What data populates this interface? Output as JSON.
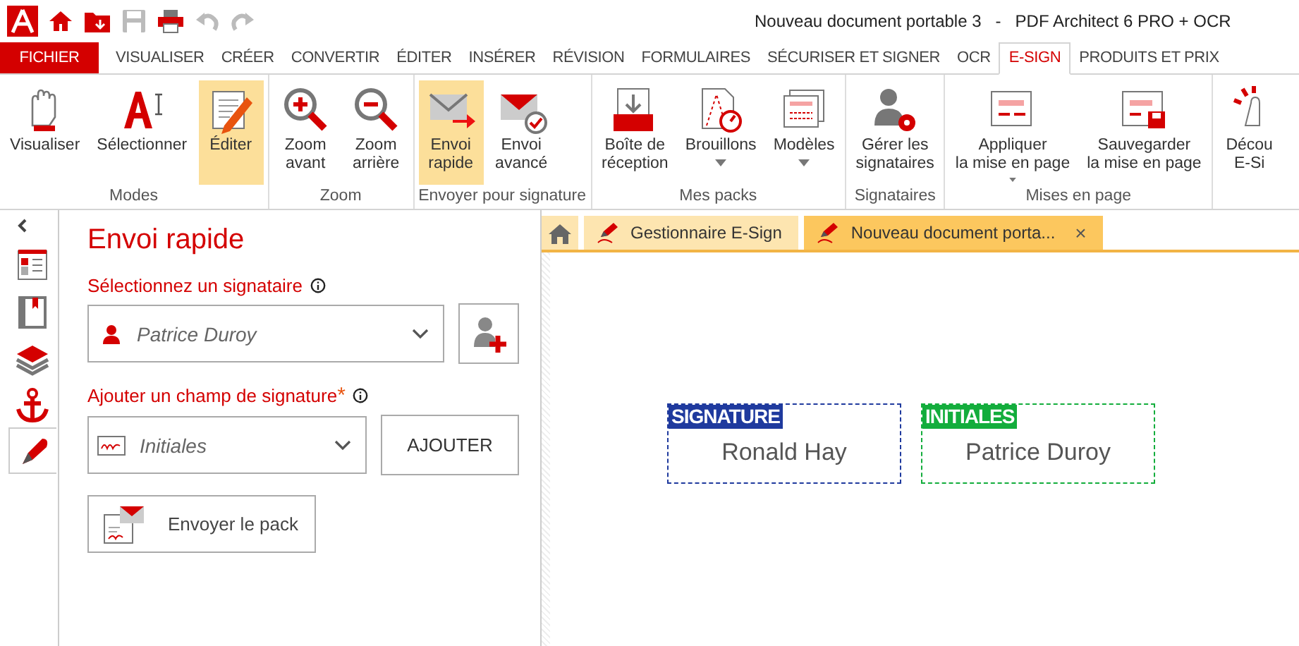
{
  "window": {
    "title": "Nouveau document portable 3   -   PDF Architect 6 PRO + OCR"
  },
  "menu": [
    {
      "label": "FICHIER",
      "kind": "file",
      "selected": false
    },
    {
      "label": "VISUALISER",
      "kind": "tab",
      "selected": false
    },
    {
      "label": "CRÉER",
      "kind": "tab",
      "selected": false
    },
    {
      "label": "CONVERTIR",
      "kind": "tab",
      "selected": false
    },
    {
      "label": "ÉDITER",
      "kind": "tab",
      "selected": false
    },
    {
      "label": "INSÉRER",
      "kind": "tab",
      "selected": false
    },
    {
      "label": "RÉVISION",
      "kind": "tab",
      "selected": false
    },
    {
      "label": "FORMULAIRES",
      "kind": "tab",
      "selected": false
    },
    {
      "label": "SÉCURISER ET SIGNER",
      "kind": "tab",
      "selected": false
    },
    {
      "label": "OCR",
      "kind": "tab",
      "selected": false
    },
    {
      "label": "E-SIGN",
      "kind": "tab",
      "selected": true
    },
    {
      "label": "PRODUITS ET PRIX",
      "kind": "tab",
      "selected": false
    }
  ],
  "ribbon": [
    {
      "label": "Modes",
      "items": [
        {
          "label": "Visualiser",
          "selected": false,
          "dropdown": false
        },
        {
          "label": "Sélectionner",
          "selected": false,
          "dropdown": false
        },
        {
          "label": "Éditer",
          "selected": true,
          "dropdown": false
        }
      ]
    },
    {
      "label": "Zoom",
      "items": [
        {
          "label": "Zoom\navant",
          "selected": false,
          "dropdown": false
        },
        {
          "label": "Zoom\narrière",
          "selected": false,
          "dropdown": false
        }
      ]
    },
    {
      "label": "Envoyer pour signature",
      "items": [
        {
          "label": "Envoi\nrapide",
          "selected": true,
          "dropdown": false
        },
        {
          "label": "Envoi\navancé",
          "selected": false,
          "dropdown": false
        }
      ]
    },
    {
      "label": "Mes packs",
      "items": [
        {
          "label": "Boîte de\nréception",
          "selected": false,
          "dropdown": false
        },
        {
          "label": "Brouillons",
          "selected": false,
          "dropdown": true
        },
        {
          "label": "Modèles",
          "selected": false,
          "dropdown": true
        }
      ]
    },
    {
      "label": "Signataires",
      "items": [
        {
          "label": "Gérer les\nsignataires",
          "selected": false,
          "dropdown": false
        }
      ]
    },
    {
      "label": "Mises en page",
      "items": [
        {
          "label": "Appliquer\nla mise en page",
          "selected": false,
          "dropdown": true
        },
        {
          "label": "Sauvegarder\nla mise en page",
          "selected": false,
          "dropdown": false
        }
      ]
    },
    {
      "items": [
        {
          "label": "Décou\nE-Si",
          "selected": false,
          "dropdown": false
        }
      ]
    }
  ],
  "side_tabs": [
    {
      "selected": false
    },
    {
      "selected": false
    },
    {
      "selected": false
    },
    {
      "selected": false
    },
    {
      "selected": true
    }
  ],
  "panel": {
    "title": "Envoi rapide",
    "signer_label": "Sélectionnez un signataire",
    "signer_value": "Patrice Duroy",
    "field_label": "Ajouter un champ de signature",
    "required_mark": "*",
    "field_value": "Initiales",
    "add_button": "AJOUTER",
    "send_button": "Envoyer le pack"
  },
  "doc_tabs": [
    {
      "kind": "home",
      "selected": false
    },
    {
      "kind": "doc",
      "label": "Gestionnaire E-Sign",
      "selected": false
    },
    {
      "kind": "doc",
      "label": "Nouveau document porta...",
      "selected": true,
      "close": "×"
    }
  ],
  "fields": [
    {
      "tag": "SIGNATURE",
      "name": "Ronald Hay",
      "color": "#1f3a9e"
    },
    {
      "tag": "INITIALES",
      "name": "Patrice Duroy",
      "color": "#13ad3c"
    }
  ]
}
